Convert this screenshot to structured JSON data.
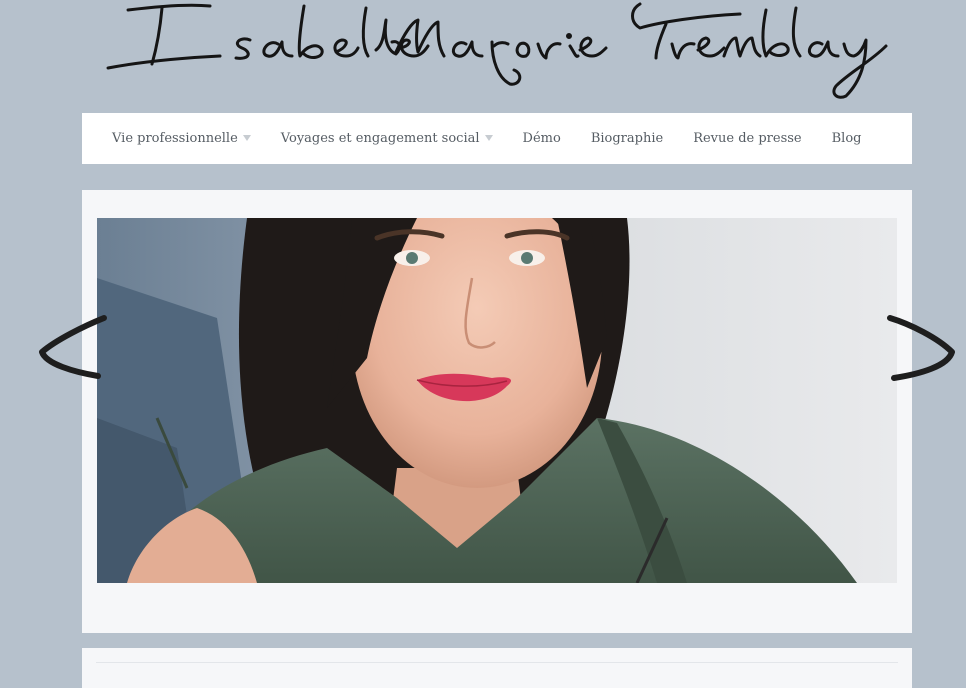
{
  "site": {
    "signature_text": "Isabelle Marjorie Tremblay"
  },
  "nav": {
    "items": [
      {
        "label": "Vie professionnelle",
        "has_submenu": true
      },
      {
        "label": "Voyages et engagement social",
        "has_submenu": true
      },
      {
        "label": "Démo",
        "has_submenu": false
      },
      {
        "label": "Biographie",
        "has_submenu": false
      },
      {
        "label": "Revue de presse",
        "has_submenu": false
      },
      {
        "label": "Blog",
        "has_submenu": false
      }
    ]
  },
  "slider": {
    "prev_icon": "handdrawn-chevron-left-icon",
    "next_icon": "handdrawn-chevron-right-icon"
  },
  "colors": {
    "page_background": "#b6c1cc",
    "panel_background": "#f6f7f9",
    "nav_background": "#ffffff",
    "nav_text": "#555c63",
    "signature_ink": "#151515"
  }
}
